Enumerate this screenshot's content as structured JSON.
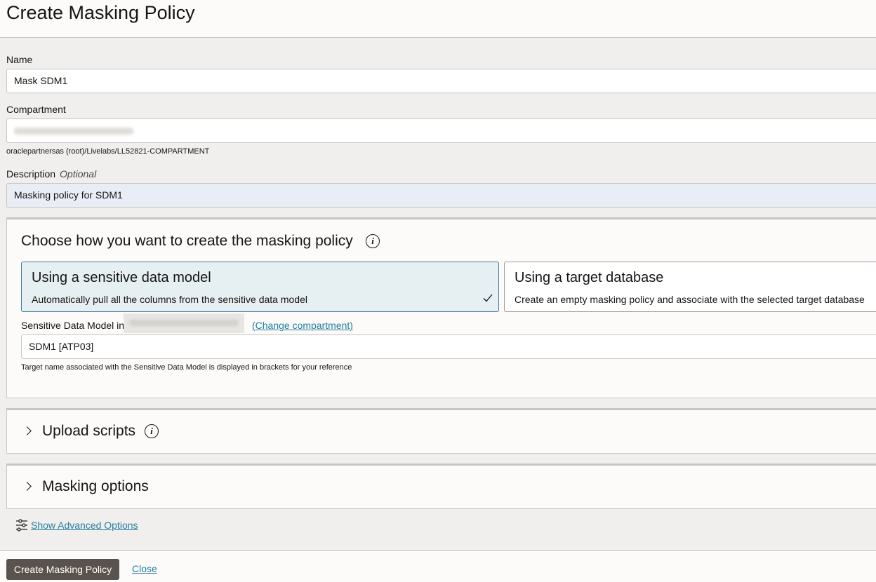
{
  "header": {
    "title": "Create Masking Policy"
  },
  "form": {
    "name_label": "Name",
    "name_value": "Mask SDM1",
    "compartment_label": "Compartment",
    "compartment_path": "oraclepartnersas (root)/Livelabs/LL52821-COMPARTMENT",
    "description_label": "Description",
    "description_optional": "Optional",
    "description_value": "Masking policy for SDM1"
  },
  "choose_section": {
    "title": "Choose how you want to create the masking policy",
    "options": [
      {
        "title": "Using a sensitive data model",
        "description": "Automatically pull all the columns from the sensitive data model",
        "selected": true
      },
      {
        "title": "Using a target database",
        "description": "Create an empty masking policy and associate with the selected target database",
        "selected": false
      }
    ],
    "sdm_label": "Sensitive Data Model in",
    "change_compartment": "(Change compartment)",
    "sdm_value": "SDM1 [ATP03]",
    "sdm_helper": "Target name associated with the Sensitive Data Model is displayed in brackets for your reference"
  },
  "upload_section": {
    "title": "Upload scripts"
  },
  "masking_section": {
    "title": "Masking options"
  },
  "advanced": {
    "label": "Show Advanced Options"
  },
  "footer": {
    "primary_label": "Create Masking Policy",
    "close_label": "Close"
  },
  "colors": {
    "primary_button": "#5a524c",
    "link": "#227e9e",
    "selected_card_bg": "#e6eff2",
    "selected_card_border": "#3c7e9a"
  }
}
